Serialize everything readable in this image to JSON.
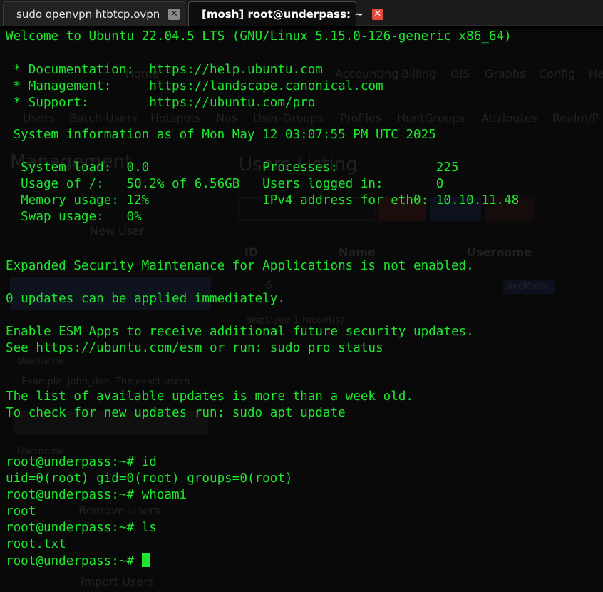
{
  "tabs": [
    {
      "label": "sudo openvpn htbtcp.ovpn",
      "active": false
    },
    {
      "label": "[mosh] root@underpass: ~",
      "active": true
    }
  ],
  "background_ui": {
    "nav_top": [
      "Home",
      "Reports",
      "Accounting",
      "Billing",
      "GIS",
      "Graphs",
      "Config",
      "He"
    ],
    "nav_sub": [
      "Users",
      "Batch Users",
      "Hotspots",
      "Nas",
      "User-Groups",
      "Profiles",
      "HuntGroups",
      "Attributes",
      "Realm/P"
    ],
    "left_title": "Management",
    "main_title": "Users Listing",
    "sidebar_links": [
      "New User",
      "Remove Users",
      "Import Users"
    ],
    "buttons": [
      "Select All",
      "Select None"
    ],
    "table_headers": [
      "ID",
      "Name",
      "Username"
    ],
    "row_id": "6",
    "row_username": "svcMosh",
    "records_text": "displayed 1 record(s)",
    "username_label": "Username",
    "username_placeholder": "Example: john_doe. The exact usern",
    "username_label_2": "Username"
  },
  "terminal": {
    "welcome": "Welcome to Ubuntu 22.04.5 LTS (GNU/Linux 5.15.0-126-generic x86_64)",
    "doc_line": " * Documentation:  https://help.ubuntu.com",
    "mgmt_line": " * Management:     https://landscape.canonical.com",
    "support_line": " * Support:        https://ubuntu.com/pro",
    "sysinfo": " System information as of Mon May 12 03:07:55 PM UTC 2025",
    "stat1": "  System load:  0.0               Processes:             225",
    "stat2": "  Usage of /:   50.2% of 6.56GB   Users logged in:       0",
    "stat3": "  Memory usage: 12%               IPv4 address for eth0: 10.10.11.48",
    "stat4": "  Swap usage:   0%",
    "esm1": "Expanded Security Maintenance for Applications is not enabled.",
    "updates": "0 updates can be applied immediately.",
    "esm2": "Enable ESM Apps to receive additional future security updates.",
    "esm3": "See https://ubuntu.com/esm or run: sudo pro status",
    "old1": "The list of available updates is more than a week old.",
    "old2": "To check for new updates run: sudo apt update",
    "cmd1": "root@underpass:~# id",
    "out1": "uid=0(root) gid=0(root) groups=0(root)",
    "cmd2": "root@underpass:~# whoami",
    "out2": "root",
    "cmd3": "root@underpass:~# ls",
    "out3": "root.txt",
    "prompt": "root@underpass:~# "
  },
  "colors": {
    "terminal_text": "#1ee62e",
    "tab_close_active": "#e24b3b",
    "background": "#0d0d0d"
  }
}
